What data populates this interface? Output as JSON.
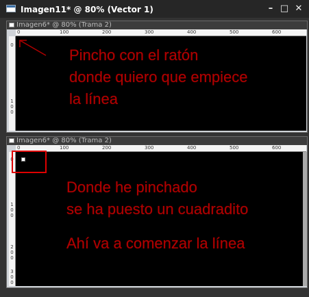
{
  "window": {
    "title": "Imagen11* @  80% (Vector 1)",
    "controls": {
      "minimize": "–",
      "maximize": "□",
      "close": "✕"
    }
  },
  "doc_top": {
    "title": "Imagen6* @  80% (Trama 2)",
    "ruler_labels": [
      "0",
      "100",
      "200",
      "300",
      "400",
      "500",
      "600"
    ],
    "vruler_labels": [
      "0",
      "1",
      "0",
      "0"
    ],
    "note_lines": [
      "Pincho con el ratón",
      "donde quiero que empiece",
      "la línea"
    ]
  },
  "doc_bottom": {
    "title": "Imagen6* @  80% (Trama 2)",
    "ruler_labels": [
      "0",
      "100",
      "200",
      "300",
      "400",
      "500",
      "600"
    ],
    "vruler_labels": [
      "0",
      "1",
      "0",
      "0",
      "2",
      "0",
      "0",
      "3",
      "0",
      "0"
    ],
    "note_lines": [
      "Donde he pinchado",
      "se ha puesto un cuadradito",
      "Ahí va a comenzar la línea"
    ]
  },
  "colors": {
    "annotation": "#b00000",
    "highlight_box": "#e00000",
    "canvas": "#000000"
  }
}
